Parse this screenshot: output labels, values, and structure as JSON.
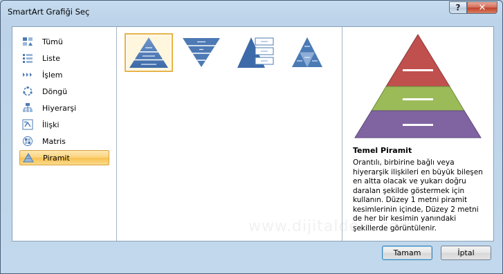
{
  "window": {
    "title": "SmartArt Grafiği Seç",
    "help_symbol": "?",
    "close_symbol": "✕"
  },
  "sidebar": {
    "items": [
      {
        "label": "Tümü",
        "icon": "all-icon"
      },
      {
        "label": "Liste",
        "icon": "list-icon"
      },
      {
        "label": "İşlem",
        "icon": "process-icon"
      },
      {
        "label": "Döngü",
        "icon": "cycle-icon"
      },
      {
        "label": "Hiyerarşi",
        "icon": "hierarchy-icon"
      },
      {
        "label": "İlişki",
        "icon": "relationship-icon"
      },
      {
        "label": "Matris",
        "icon": "matrix-icon"
      },
      {
        "label": "Piramit",
        "icon": "pyramid-icon",
        "selected": true
      }
    ]
  },
  "gallery": {
    "items": [
      {
        "name": "basic-pyramid-thumb",
        "selected": true
      },
      {
        "name": "inverted-pyramid-thumb"
      },
      {
        "name": "pyramid-list-thumb"
      },
      {
        "name": "segmented-pyramid-thumb"
      }
    ]
  },
  "preview": {
    "title": "Temel Piramit",
    "description": "Orantılı, birbirine bağlı veya hiyerarşik ilişkileri en büyük bileşen en altta olacak ve yukarı doğru daralan şekilde göstermek için kullanın. Düzey 1 metni piramit kesimlerinin içinde, Düzey 2 metni de her bir kesimin yanındaki şekillerde görüntülenir.",
    "colors": {
      "top": "#c0504d",
      "middle": "#9bbb59",
      "bottom": "#8064a2"
    }
  },
  "watermark": "www.dijitalders.com",
  "buttons": {
    "ok": "Tamam",
    "cancel": "İptal"
  }
}
